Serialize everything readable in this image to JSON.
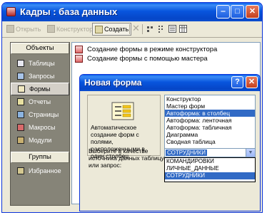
{
  "window": {
    "title": "Кадры : база данных"
  },
  "toolbar": {
    "open_label": "Открыть",
    "designer_label": "Конструктор",
    "create_label": "Создать"
  },
  "sidebar": {
    "objects_header": "Объекты",
    "items": [
      {
        "label": "Таблицы",
        "icon": "table-icon"
      },
      {
        "label": "Запросы",
        "icon": "query-icon"
      },
      {
        "label": "Формы",
        "icon": "form-icon"
      },
      {
        "label": "Отчеты",
        "icon": "report-icon"
      },
      {
        "label": "Страницы",
        "icon": "page-icon"
      },
      {
        "label": "Макросы",
        "icon": "macro-icon"
      },
      {
        "label": "Модули",
        "icon": "module-icon"
      }
    ],
    "groups_header": "Группы",
    "favorites_label": "Избранное"
  },
  "main_list": {
    "items": [
      "Создание формы в режиме конструктора",
      "Создание формы с помощью мастера"
    ]
  },
  "dialog": {
    "title": "Новая форма",
    "description": "Автоматическое создание форм с полями, расположенными в один столбец.",
    "form_types": [
      "Конструктор",
      "Мастер форм",
      "Автоформа: в столбец",
      "Автоформа: ленточная",
      "Автоформа: табличная",
      "Диаграмма",
      "Сводная таблица"
    ],
    "selected_form_type": "Автоформа: в столбец",
    "source_label": "Выберите в качестве источника данных таблицу или запрос:",
    "source_value": "СОТРУДНИКИ",
    "source_options": [
      "КОМАНДИРОВКИ",
      "ЛИЧНЫЕ_ДАННЫЕ",
      "СОТРУДНИКИ"
    ]
  },
  "colors": {
    "titlebar": "#0855dd",
    "selection": "#316ac5",
    "sidebar_bg": "#868478",
    "dialog_bg": "#ece9d8"
  }
}
